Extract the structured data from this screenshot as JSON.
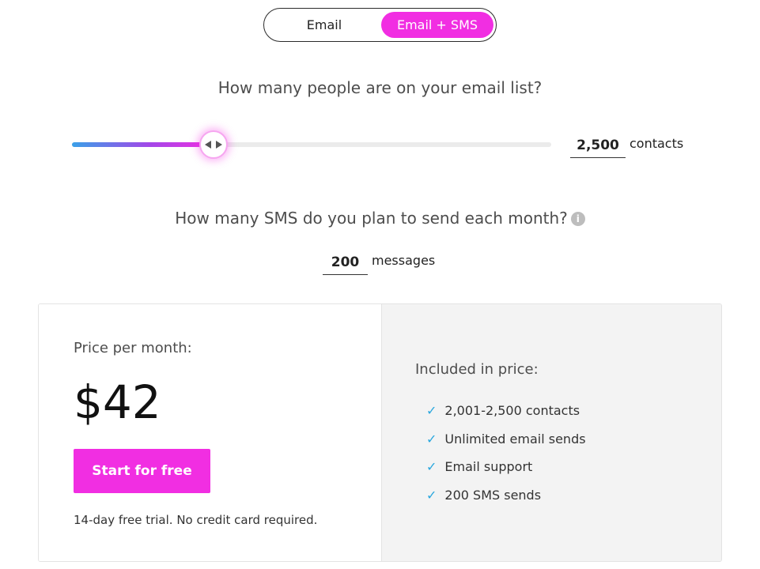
{
  "plan_toggle": {
    "options": [
      "Email",
      "Email + SMS"
    ],
    "selected": "Email + SMS"
  },
  "contacts_question": "How many people are on your email list?",
  "contacts_slider": {
    "fraction": 0.295
  },
  "contacts": {
    "value": "2,500",
    "unit": "contacts"
  },
  "sms_question": "How many SMS do you plan to send each month?",
  "sms": {
    "value": "200",
    "unit": "messages"
  },
  "pricing": {
    "price_label": "Price per month:",
    "price": "$42",
    "cta_label": "Start for free",
    "trial_note": "14-day free trial. No credit card required."
  },
  "included": {
    "title": "Included in price:",
    "items": [
      "2,001-2,500 contacts",
      "Unlimited email sends",
      "Email support",
      "200 SMS sends"
    ]
  },
  "colors": {
    "accent": "#f12ee2",
    "check": "#2aa7de",
    "slider_start": "#3aa0e8",
    "panel_bg": "#f3f3f3"
  },
  "icons": {
    "slider_thumb": "arrows-left-right-icon",
    "info": "info-icon",
    "check": "check-icon"
  }
}
